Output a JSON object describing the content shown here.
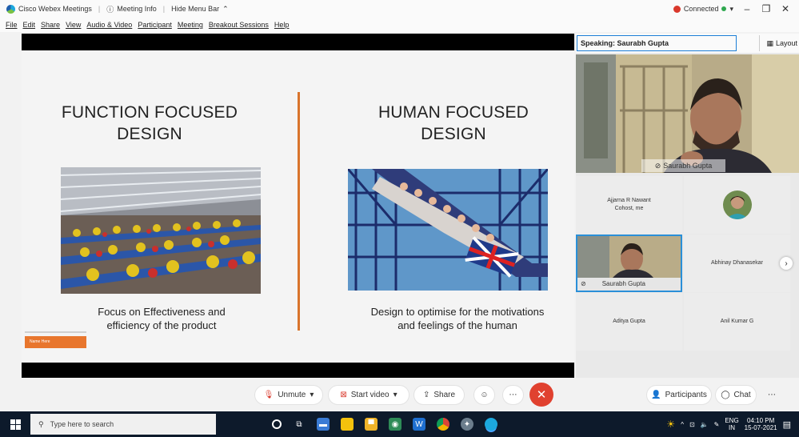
{
  "titlebar": {
    "app_title": "Cisco Webex Meetings",
    "meeting_info": "Meeting Info",
    "hide_menu": "Hide Menu Bar",
    "connection": "Connected"
  },
  "menu": [
    "File",
    "Edit",
    "Share",
    "View",
    "Audio & Video",
    "Participant",
    "Meeting",
    "Breakout Sessions",
    "Help"
  ],
  "slide": {
    "left_title_1": "FUNCTION FOCUSED",
    "left_title_2": "DESIGN",
    "left_caption_1": "Focus on Effectiveness and",
    "left_caption_2": "efficiency of the product",
    "right_title_1": "HUMAN FOCUSED",
    "right_title_2": "DESIGN",
    "right_caption_1": "Design to optimise for the motivations",
    "right_caption_2": "and feelings of the human",
    "footer_tag": "Name Here"
  },
  "panel": {
    "speaking": "Speaking: Saurabh Gupta",
    "layout": "Layout",
    "main_name": "Saurabh Gupta",
    "tiles": [
      {
        "name": "Ajjarna R Nawant",
        "sub": "Cohost, me"
      },
      {
        "name": ""
      },
      {
        "name": "Saurabh Gupta"
      },
      {
        "name": "Abhinay Dhanasekar"
      },
      {
        "name": "Aditya Gupta"
      },
      {
        "name": "Anil Kumar G"
      }
    ]
  },
  "controls": {
    "unmute": "Unmute",
    "start_video": "Start video",
    "share": "Share",
    "participants": "Participants",
    "chat": "Chat"
  },
  "taskbar": {
    "search_placeholder": "Type here to search",
    "lang_1": "ENG",
    "lang_2": "IN",
    "time": "04:10 PM",
    "date": "15-07-2021"
  }
}
